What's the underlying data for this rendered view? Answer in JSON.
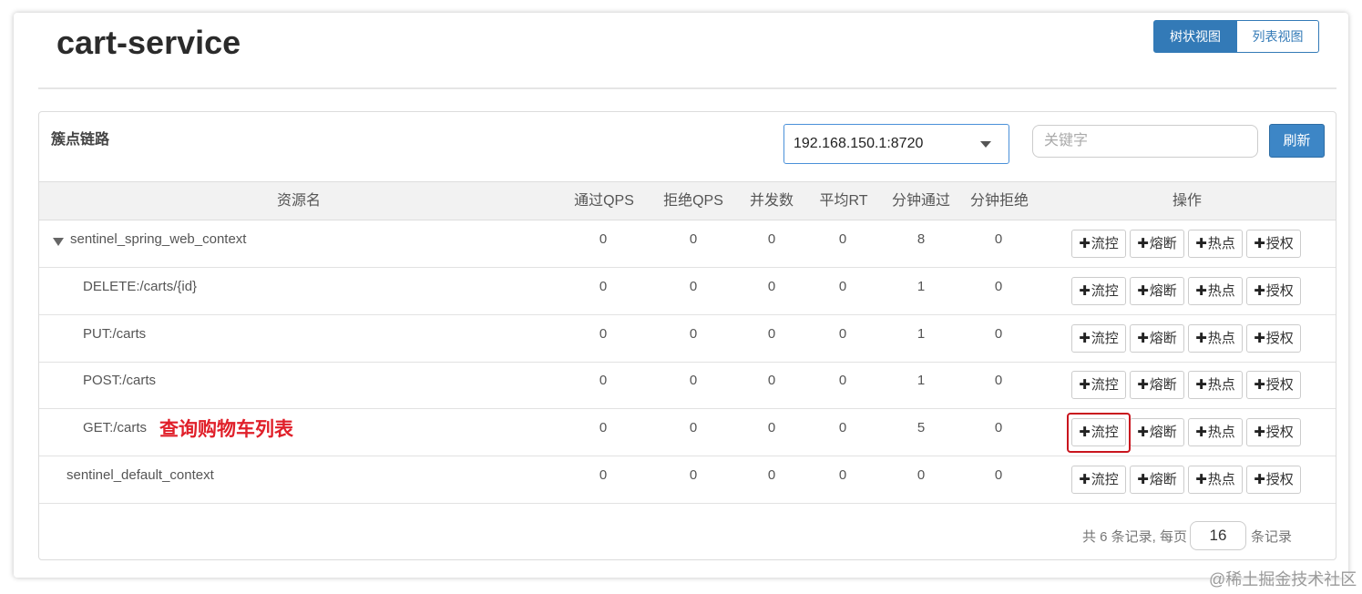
{
  "header": {
    "title": "cart-service",
    "view_toggle": {
      "tree": "树状视图",
      "list": "列表视图"
    }
  },
  "panel": {
    "title": "簇点链路",
    "machine_select": "192.168.150.1:8720",
    "keyword_placeholder": "关键字",
    "refresh_label": "刷新"
  },
  "table": {
    "columns": [
      "资源名",
      "通过QPS",
      "拒绝QPS",
      "并发数",
      "平均RT",
      "分钟通过",
      "分钟拒绝",
      "操作"
    ],
    "rows": [
      {
        "name": "sentinel_spring_web_context",
        "pass_qps": "0",
        "block_qps": "0",
        "concurrency": "0",
        "avg_rt": "0",
        "min_pass": "8",
        "min_block": "0"
      },
      {
        "name": "DELETE:/carts/{id}",
        "pass_qps": "0",
        "block_qps": "0",
        "concurrency": "0",
        "avg_rt": "0",
        "min_pass": "1",
        "min_block": "0"
      },
      {
        "name": "PUT:/carts",
        "pass_qps": "0",
        "block_qps": "0",
        "concurrency": "0",
        "avg_rt": "0",
        "min_pass": "1",
        "min_block": "0"
      },
      {
        "name": "POST:/carts",
        "pass_qps": "0",
        "block_qps": "0",
        "concurrency": "0",
        "avg_rt": "0",
        "min_pass": "1",
        "min_block": "0"
      },
      {
        "name": "GET:/carts",
        "annotation": "查询购物车列表",
        "pass_qps": "0",
        "block_qps": "0",
        "concurrency": "0",
        "avg_rt": "0",
        "min_pass": "5",
        "min_block": "0"
      },
      {
        "name": "sentinel_default_context",
        "pass_qps": "0",
        "block_qps": "0",
        "concurrency": "0",
        "avg_rt": "0",
        "min_pass": "0",
        "min_block": "0"
      }
    ],
    "actions": {
      "flow": "流控",
      "degrade": "熔断",
      "hotspot": "热点",
      "auth": "授权"
    }
  },
  "pagination": {
    "summary": "共 6 条记录, 每页",
    "page_size": "16",
    "suffix": "条记录"
  },
  "watermark": "@稀土掘金技术社区",
  "colors": {
    "primary": "#337ab7",
    "highlight": "#c9151e",
    "annotation": "#e0202a"
  }
}
